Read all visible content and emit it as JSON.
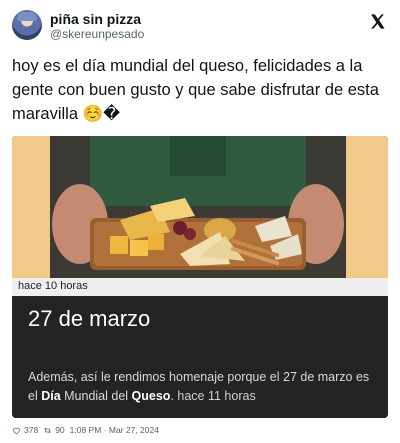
{
  "author": {
    "display_name": "piña sin pizza",
    "handle": "@skereunpesado"
  },
  "tweet": {
    "text": "hoy es el día mundial del queso, felicidades a la gente con buen gusto y que sabe disfrutar de esta maravilla ☺️�"
  },
  "card": {
    "time_strip": "hace 10 horas",
    "date_big": "27 de marzo",
    "body_prefix": "Además, así le rendimos homenaje porque el 27 de marzo es el ",
    "bold_1": "Día",
    "mid_1": " Mundial del ",
    "bold_2": "Queso",
    "after": ".",
    "ago": "hace 11 horas"
  },
  "stats": {
    "likes": "378",
    "retweets": "90",
    "timestamp": "1:08 PM · Mar 27, 2024"
  },
  "colors": {
    "accent_bg": "#f3c98a",
    "card_dark": "#232323",
    "muted": "#536471"
  },
  "icons": [
    "x-logo-icon",
    "heart-icon",
    "retweet-icon"
  ]
}
